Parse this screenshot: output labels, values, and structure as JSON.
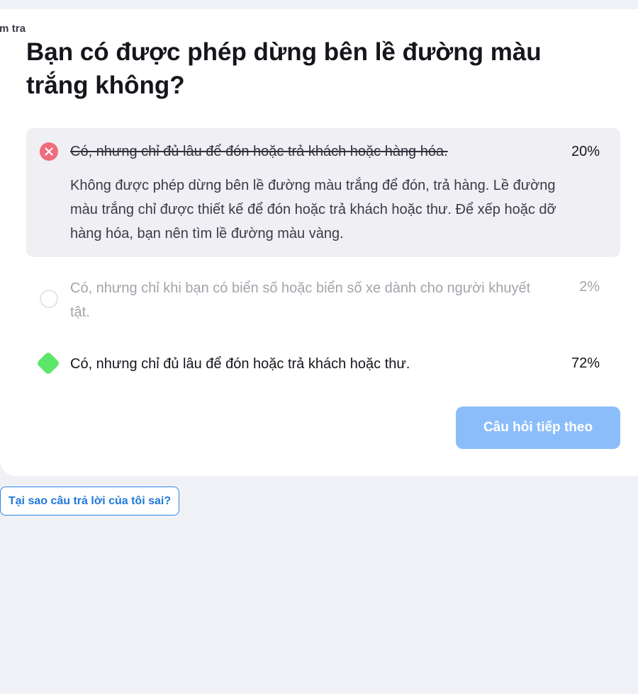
{
  "header": {
    "cut_label": "m tra"
  },
  "question": {
    "text": "Bạn có được phép dừng bên lề đường màu trắng không?"
  },
  "answers": [
    {
      "text": "Có, nhưng chỉ đủ lâu để đón hoặc trả khách hoặc hàng hóa.",
      "percent": "20%",
      "status": "selected-wrong",
      "explanation": "Không được phép dừng bên lề đường màu trắng để đón, trả hàng. Lề đường màu trắng chỉ được thiết kế để đón hoặc trả khách hoặc thư. Để xếp hoặc dỡ hàng hóa, bạn nên tìm lề đường màu vàng."
    },
    {
      "text": "Có, nhưng chỉ khi bạn có biển số hoặc biển số xe dành cho người khuyết tật.",
      "percent": "2%",
      "status": "unselected"
    },
    {
      "text": "Có, nhưng chỉ đủ lâu để đón hoặc trả khách hoặc thư.",
      "percent": "72%",
      "status": "correct"
    }
  ],
  "next_button": {
    "label": "Câu hỏi tiếp theo"
  },
  "why_link": {
    "label": "Tại sao câu trả lời của tôi sai?"
  },
  "icons": {
    "wrong": "close-circle-icon",
    "unselected": "radio-empty-icon",
    "correct": "check-diamond-icon"
  },
  "colors": {
    "wrong": "#ef6d7b",
    "correct": "#5ce66a",
    "button": "#8bbdfa",
    "link": "#1f78d8",
    "background": "#f0f1f6"
  }
}
